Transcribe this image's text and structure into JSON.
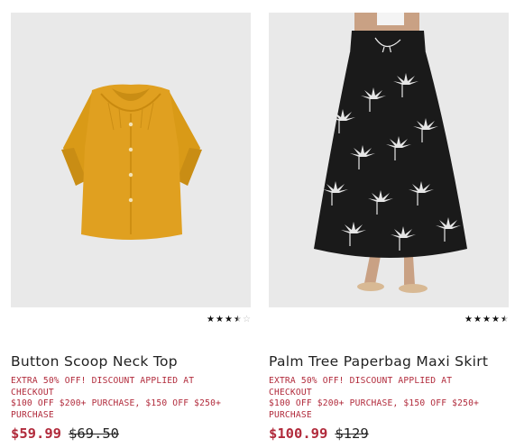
{
  "products": [
    {
      "name": "Button Scoop Neck Top",
      "rating": {
        "value": 3.5,
        "max": 5
      },
      "promo_line1": "EXTRA 50% OFF! DISCOUNT APPLIED AT",
      "promo_line2": "CHECKOUT",
      "promo_line3": "$100 OFF $200+ PURCHASE, $150 OFF $250+",
      "promo_line4": "PURCHASE",
      "sale_price": "$59.99",
      "original_price": "$69.50",
      "image_bg": "#e9e9e9",
      "garment_color": "#e0a020"
    },
    {
      "name": "Palm Tree Paperbag Maxi Skirt",
      "rating": {
        "value": 4.5,
        "max": 5
      },
      "promo_line1": "EXTRA 50% OFF! DISCOUNT APPLIED AT",
      "promo_line2": "CHECKOUT",
      "promo_line3": "$100 OFF $200+ PURCHASE, $150 OFF $250+",
      "promo_line4": "PURCHASE",
      "sale_price": "$100.99",
      "original_price": "$129",
      "image_bg": "#e9e9e9",
      "garment_color": "#1a1a1a"
    }
  ],
  "colors": {
    "sale": "#b12a3b",
    "text": "#222222",
    "star": "#111111"
  },
  "icons": {
    "rating": "star-icon"
  }
}
